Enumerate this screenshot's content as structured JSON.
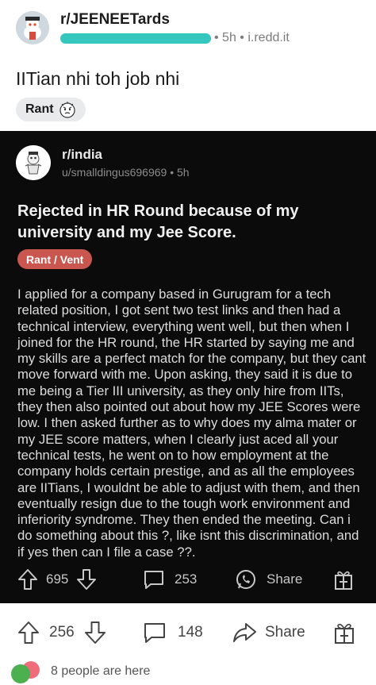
{
  "outer_post": {
    "subreddit": "r/JEENEETards",
    "meta": "• 5h • i.redd.it",
    "title": "IITian nhi toh job nhi",
    "flair": "Rant"
  },
  "inner_post": {
    "subreddit": "r/india",
    "user_meta": "u/smalldingus696969 • 5h",
    "title": "Rejected in HR Round because of my university and my Jee Score.",
    "flair": "Rant / Vent",
    "body": "I applied for a company based in Gurugram for a tech related position, I got sent two test links and then had a technical interview, everything went well, but then when I joined for the HR round, the HR started by saying me and my skills are a perfect match for the company, but they cant move forward with me. Upon asking, they said it is due to me being a Tier III university, as they only hire from IITs, they then also pointed out about how my JEE Scores were low. I then asked further as to why does my alma mater or my JEE score matters, when I clearly just aced all your technical tests, he went on to how employment at the company holds certain prestige, and as all the employees are IITians, I wouldnt be able to adjust with them, and then eventually resign due to the tough work environment and inferiority syndrome. They then ended the meeting. Can i do something about this ?, like isnt this discrimination, and if yes then can I file a case ??.",
    "votes": "695",
    "comments": "253",
    "share": "Share"
  },
  "outer_actions": {
    "votes": "256",
    "comments": "148",
    "share": "Share"
  },
  "presence": {
    "text": "8 people are here"
  },
  "colors": {
    "dark_bg": "#0b0b0c",
    "flair_red": "#c9564f",
    "redaction": "#35c6bd"
  }
}
